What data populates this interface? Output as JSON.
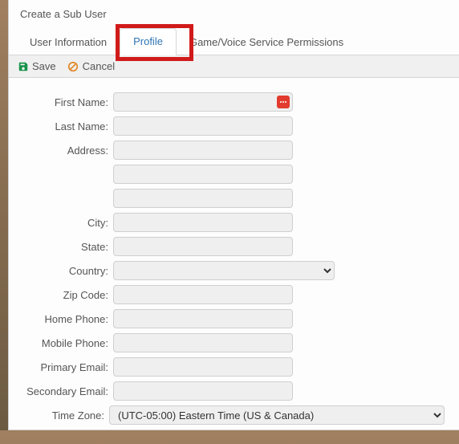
{
  "header": {
    "title": "Create a Sub User"
  },
  "tabs": [
    {
      "label": "User Information",
      "active": false
    },
    {
      "label": "Profile",
      "active": true
    },
    {
      "label": "Game/Voice Service Permissions",
      "active": false
    }
  ],
  "toolbar": {
    "save": "Save",
    "cancel": "Cancel"
  },
  "form": {
    "first_name": {
      "label": "First Name:",
      "value": ""
    },
    "last_name": {
      "label": "Last Name:",
      "value": ""
    },
    "address": {
      "label": "Address:",
      "value1": "",
      "value2": "",
      "value3": ""
    },
    "city": {
      "label": "City:",
      "value": ""
    },
    "state": {
      "label": "State:",
      "value": ""
    },
    "country": {
      "label": "Country:",
      "value": ""
    },
    "zip": {
      "label": "Zip Code:",
      "value": ""
    },
    "home_phone": {
      "label": "Home Phone:",
      "value": ""
    },
    "mobile_phone": {
      "label": "Mobile Phone:",
      "value": ""
    },
    "primary_email": {
      "label": "Primary Email:",
      "value": ""
    },
    "secondary_email": {
      "label": "Secondary Email:",
      "value": ""
    },
    "time_zone": {
      "label": "Time Zone:",
      "value": "(UTC-05:00) Eastern Time (US & Canada)"
    }
  },
  "icons": {
    "save": "save-icon",
    "cancel": "cancel-icon",
    "required": "required-icon"
  }
}
